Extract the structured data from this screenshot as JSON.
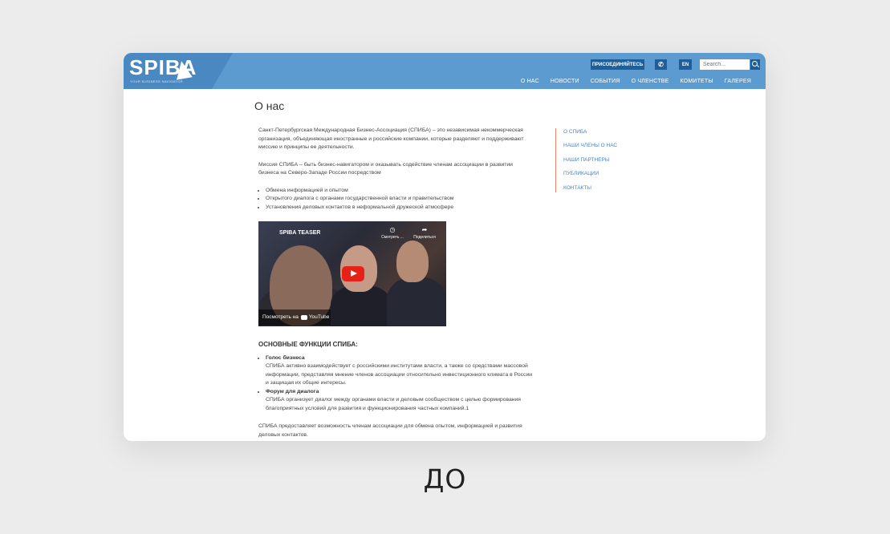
{
  "header": {
    "logo_text": "SPIBA",
    "logo_tagline": "YOUR BUSINESS NAVIGATOR",
    "join_label": "ПРИСОЕДИНЯЙТЕСЬ",
    "phone_icon": "phone-icon",
    "lang_label": "EN",
    "search_placeholder": "Search...",
    "search_icon": "search-icon",
    "brand_color": "#5b9bd0",
    "nav": [
      "О НАС",
      "НОВОСТИ",
      "СОБЫТИЯ",
      "О ЧЛЕНСТВЕ",
      "КОМИТЕТЫ",
      "ГАЛЕРЕЯ"
    ]
  },
  "page": {
    "title": "О нас",
    "intro": "Санкт-Петербургская Международная Бизнес-Ассоциация (СПИБА) – это независимая некоммерческая организация, объединяющая иностранные и российские компании, которые разделяют и поддерживают миссию и принципы ее деятельности.",
    "mission": "Миссия СПИБА – быть бизнес-навигатором и оказывать содействие членам ассоциации в развитии бизнеса на Северо-Западе России посредством",
    "mission_items": [
      "Обмена информацией и опытом",
      "Открытого диалога с органами государственной   власти и правительством",
      "Установления деловых контактов в неформальной дружеской атмосфере"
    ],
    "video": {
      "title": "SPIBA TEASER",
      "watch_label": "Смотреть ...",
      "share_label": "Поделиться",
      "watch_on": "Посмотреть на",
      "youtube": "YouTube",
      "play_color": "#e62117"
    },
    "functions_title": "ОСНОВНЫЕ ФУНКЦИИ СПИБА:",
    "functions": [
      {
        "name": "Голос бизнеса",
        "text": "СПИБА активно взаимодействует с российскими институтами власти, а также со средствами массовой информации, представляя мнение членов ассоциации относительно инвестиционного климата в России и защищая их общие интересы."
      },
      {
        "name": "Форум для диалога",
        "text": "СПИБА организует диалог между органами власти и деловым сообществом с целью формирования благоприятных условий для развития и функционирования частных компаний.1"
      }
    ],
    "closing": "СПИБА предоставляет возможность членам ассоциации для обмена опытом, информацией и развития деловых контактов."
  },
  "sidebar": {
    "items": [
      "О СПИБА",
      "НАШИ ЧЛЕНЫ О НАС",
      "НАШИ ПАРТНЕРЫ",
      "ПУБЛИКАЦИИ",
      "КОНТАКТЫ"
    ],
    "accent_color": "#e8896a"
  },
  "caption": "ДО"
}
